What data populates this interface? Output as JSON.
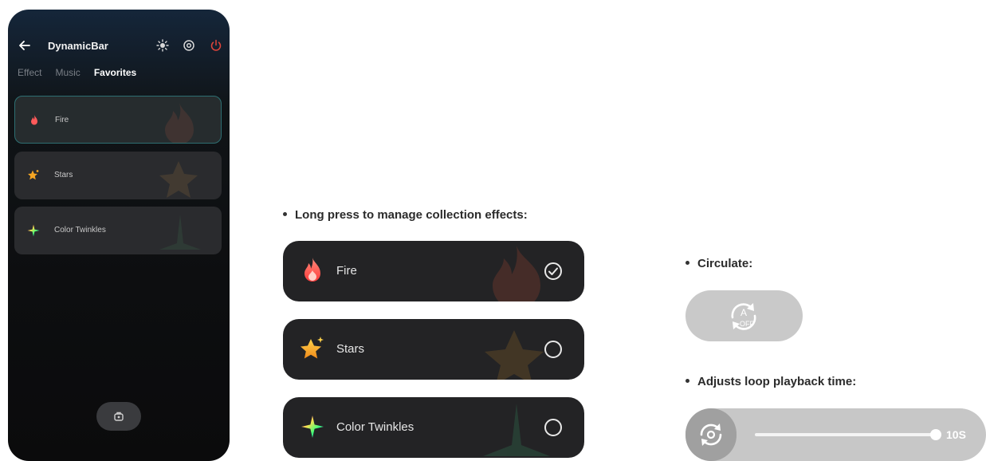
{
  "phone": {
    "title": "DynamicBar",
    "tabs": [
      {
        "label": "Effect",
        "active": false
      },
      {
        "label": "Music",
        "active": false
      },
      {
        "label": "Favorites",
        "active": true
      }
    ],
    "favorites": [
      {
        "label": "Fire",
        "icon": "fire-icon",
        "selected": true
      },
      {
        "label": "Stars",
        "icon": "star-icon",
        "selected": false
      },
      {
        "label": "Color Twinkles",
        "icon": "twinkle-icon",
        "selected": false
      }
    ]
  },
  "manage": {
    "caption": "Long press to manage collection effects:",
    "items": [
      {
        "label": "Fire",
        "icon": "fire-icon",
        "checked": true
      },
      {
        "label": "Stars",
        "icon": "star-icon",
        "checked": false
      },
      {
        "label": "Color Twinkles",
        "icon": "twinkle-icon",
        "checked": false
      }
    ]
  },
  "circulate": {
    "caption": "Circulate:",
    "state_label": "OFF",
    "mode_letter": "A"
  },
  "loop": {
    "caption": "Adjusts loop playback time:",
    "value_label": "10S",
    "slider_fraction": 1.0
  },
  "colors": {
    "accent_border": "#2e6f72",
    "fire": "#ff5a5a",
    "star": "#f5a623",
    "power": "#e0443a"
  }
}
